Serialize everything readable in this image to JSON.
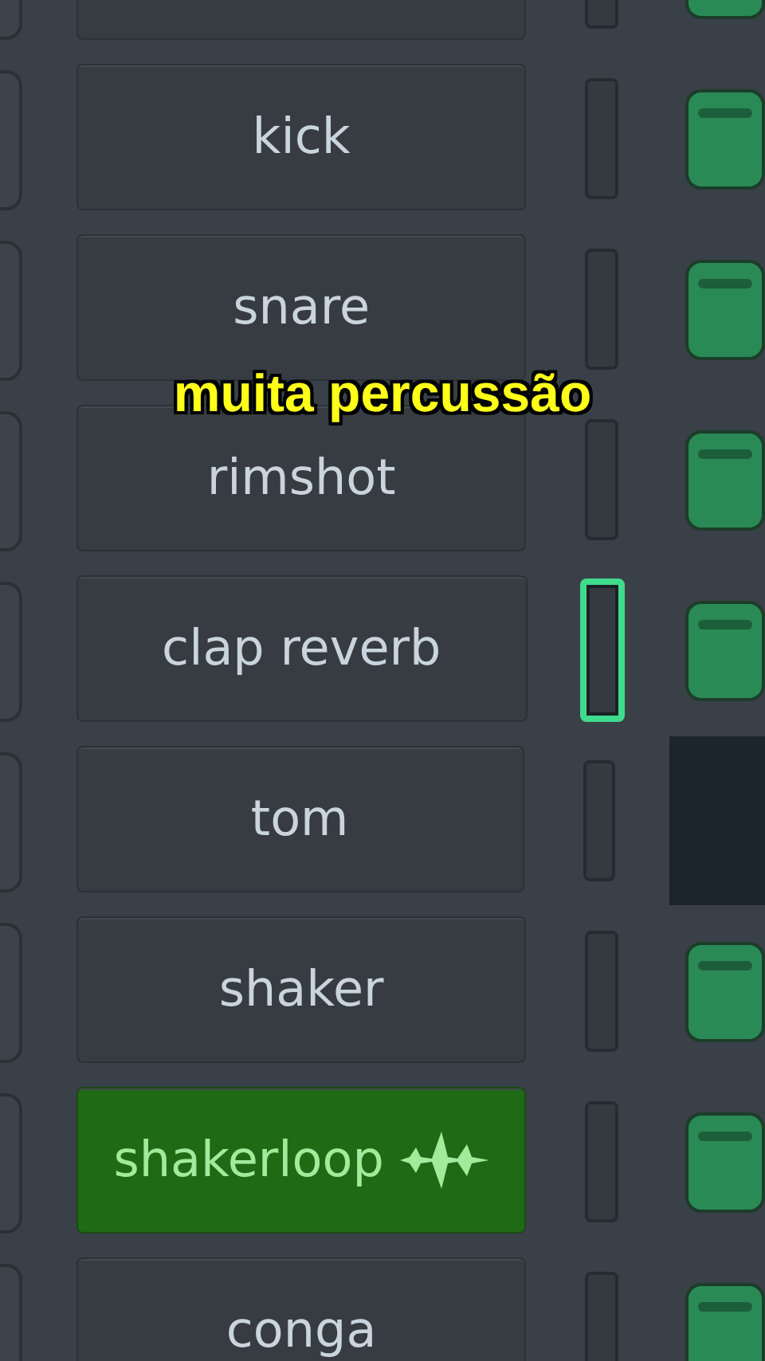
{
  "channels": [
    {
      "kind": "sample",
      "selected": false,
      "pad": true
    },
    {
      "label": "kick",
      "kind": "sample",
      "selected": false,
      "pad": true
    },
    {
      "label": "snare",
      "kind": "sample",
      "selected": false,
      "pad": true
    },
    {
      "label": "rimshot",
      "kind": "sample",
      "selected": false,
      "pad": true
    },
    {
      "label": "clap reverb",
      "kind": "sample",
      "selected": true,
      "pad": true
    },
    {
      "label": "tom",
      "kind": "sample",
      "selected": false,
      "pad": false
    },
    {
      "label": "shaker",
      "kind": "sample",
      "selected": false,
      "pad": true
    },
    {
      "label": "shakerloop",
      "kind": "loop",
      "selected": false,
      "pad": true
    },
    {
      "label": "conga",
      "kind": "sample",
      "selected": false,
      "pad": true
    }
  ],
  "caption": "muita percussão"
}
